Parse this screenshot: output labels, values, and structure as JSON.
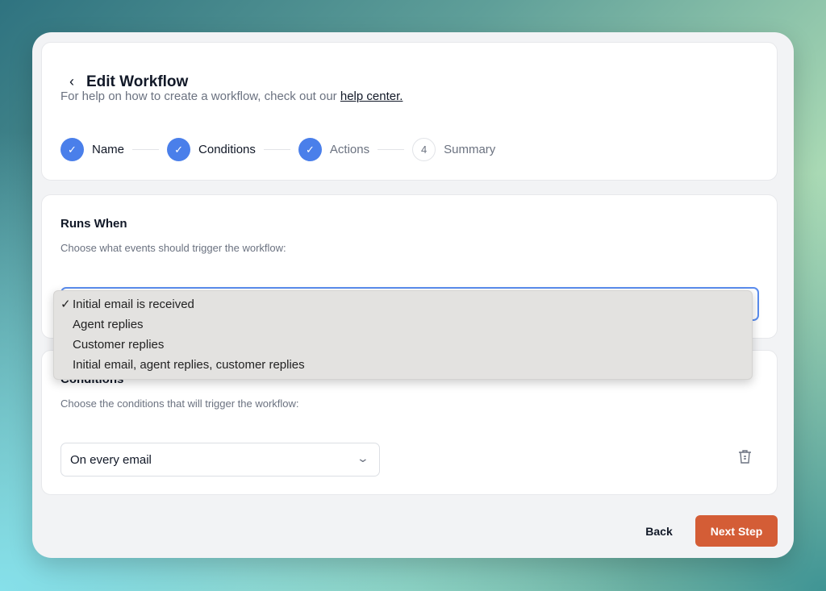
{
  "header": {
    "title": "Edit Workflow",
    "help_text": "For help on how to create a workflow, check out our ",
    "help_link": "help center."
  },
  "steps": [
    {
      "num": "1",
      "label": "Name",
      "state": "done"
    },
    {
      "num": "2",
      "label": "Conditions",
      "state": "done"
    },
    {
      "num": "3",
      "label": "Actions",
      "state": "done"
    },
    {
      "num": "4",
      "label": "Summary",
      "state": "todo"
    }
  ],
  "runs_when": {
    "title": "Runs When",
    "description": "Choose what events should trigger the workflow:",
    "options": [
      "Initial email is received",
      "Agent replies",
      "Customer replies",
      "Initial email, agent replies, customer replies"
    ],
    "selected": "Initial email is received"
  },
  "conditions": {
    "title": "Conditions",
    "description": "Choose the conditions that will trigger the workflow:",
    "select_value": "On every email"
  },
  "footer": {
    "back": "Back",
    "next": "Next Step"
  },
  "colors": {
    "accent": "#4a7fea",
    "primary_button": "#d45d36"
  }
}
